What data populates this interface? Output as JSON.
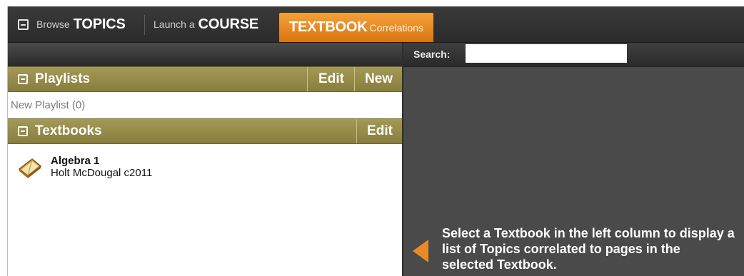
{
  "nav": {
    "browse": {
      "small": "Browse",
      "big": "TOPICS"
    },
    "launch": {
      "small": "Launch a",
      "big": "COURSE"
    },
    "textbook": {
      "big": "TEXTBOOK",
      "small": "Correlations"
    },
    "active_color": "#e8891f"
  },
  "search": {
    "label": "Search:",
    "value": "",
    "placeholder": ""
  },
  "playlists": {
    "title": "Playlists",
    "edit_label": "Edit",
    "new_label": "New",
    "items": [
      "New Playlist (0)"
    ]
  },
  "textbooks": {
    "title": "Textbooks",
    "edit_label": "Edit",
    "items": [
      {
        "title": "Algebra 1",
        "publisher": "Holt McDougal c2011",
        "icon": "textbook-icon"
      }
    ]
  },
  "hint": {
    "text": "Select a Textbook in the left column to display a list of Topics correlated to pages in the selected Textbook.",
    "arrow_color": "#e98a2a"
  },
  "colors": {
    "section_bar": "#958b4a",
    "right_panel": "#4a4a4a"
  }
}
